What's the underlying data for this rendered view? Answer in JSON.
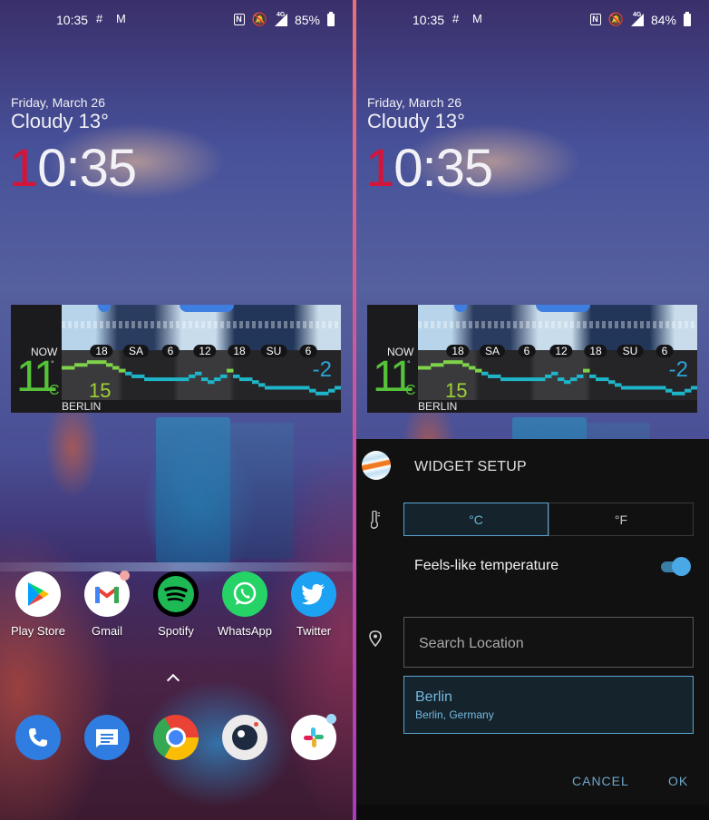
{
  "screens": [
    {
      "status_bar": {
        "time": "10:35",
        "notifications": [
          "slack-icon",
          "gmail-icon"
        ],
        "icons": [
          "nfc-icon",
          "bell-muted-icon",
          "signal-4g-icon"
        ],
        "network": "4G",
        "battery": "85%"
      },
      "lockscreen": {
        "date": "Friday, March 26",
        "weather": "Cloudy 13°",
        "clock": {
          "first_digit": "1",
          "rest": "0:35"
        }
      }
    },
    {
      "status_bar": {
        "time": "10:35",
        "notifications": [
          "slack-icon",
          "gmail-icon"
        ],
        "icons": [
          "nfc-icon",
          "bell-muted-icon",
          "signal-4g-icon"
        ],
        "network": "4G",
        "battery": "84%"
      },
      "lockscreen": {
        "date": "Friday, March 26",
        "weather": "Cloudy 13°",
        "clock": {
          "first_digit": "1",
          "rest": "0:35"
        }
      }
    }
  ],
  "widget": {
    "now_label": "NOW",
    "current_temp": "11",
    "degree": "°",
    "unit": "C",
    "high": "15",
    "low": "-2",
    "city": "BERLIN",
    "ticks": [
      "18",
      "SA",
      "6",
      "12",
      "18",
      "SU",
      "6"
    ],
    "colors": {
      "current": "#56c23a",
      "high": "#9fd234",
      "low": "#2ba4d8"
    },
    "temp_series_approx": [
      13,
      13,
      14,
      14,
      15,
      15,
      15,
      14,
      13,
      12,
      11,
      10,
      10,
      9,
      9,
      9,
      9,
      9,
      9,
      9,
      10,
      11,
      9,
      8,
      9,
      10,
      12,
      10,
      9,
      9,
      8,
      7,
      6,
      6,
      6,
      6,
      6,
      6,
      6,
      5,
      4,
      4,
      5,
      6
    ]
  },
  "home": {
    "apps": [
      {
        "name": "play-store",
        "label": "Play Store"
      },
      {
        "name": "gmail",
        "label": "Gmail"
      },
      {
        "name": "spotify",
        "label": "Spotify"
      },
      {
        "name": "whatsapp",
        "label": "WhatsApp"
      },
      {
        "name": "twitter",
        "label": "Twitter"
      }
    ],
    "dock": [
      {
        "name": "phone"
      },
      {
        "name": "messages"
      },
      {
        "name": "chrome"
      },
      {
        "name": "camera"
      },
      {
        "name": "slack"
      }
    ]
  },
  "dialog": {
    "title": "WIDGET SETUP",
    "units": [
      {
        "label": "°C",
        "selected": true
      },
      {
        "label": "°F",
        "selected": false
      }
    ],
    "feels_like_label": "Feels-like temperature",
    "feels_like_enabled": true,
    "search_placeholder": "Search Location",
    "result": {
      "name": "Berlin",
      "detail": "Berlin, Germany"
    },
    "cancel_label": "CANCEL",
    "ok_label": "OK",
    "accent": "#5aa6d0"
  }
}
